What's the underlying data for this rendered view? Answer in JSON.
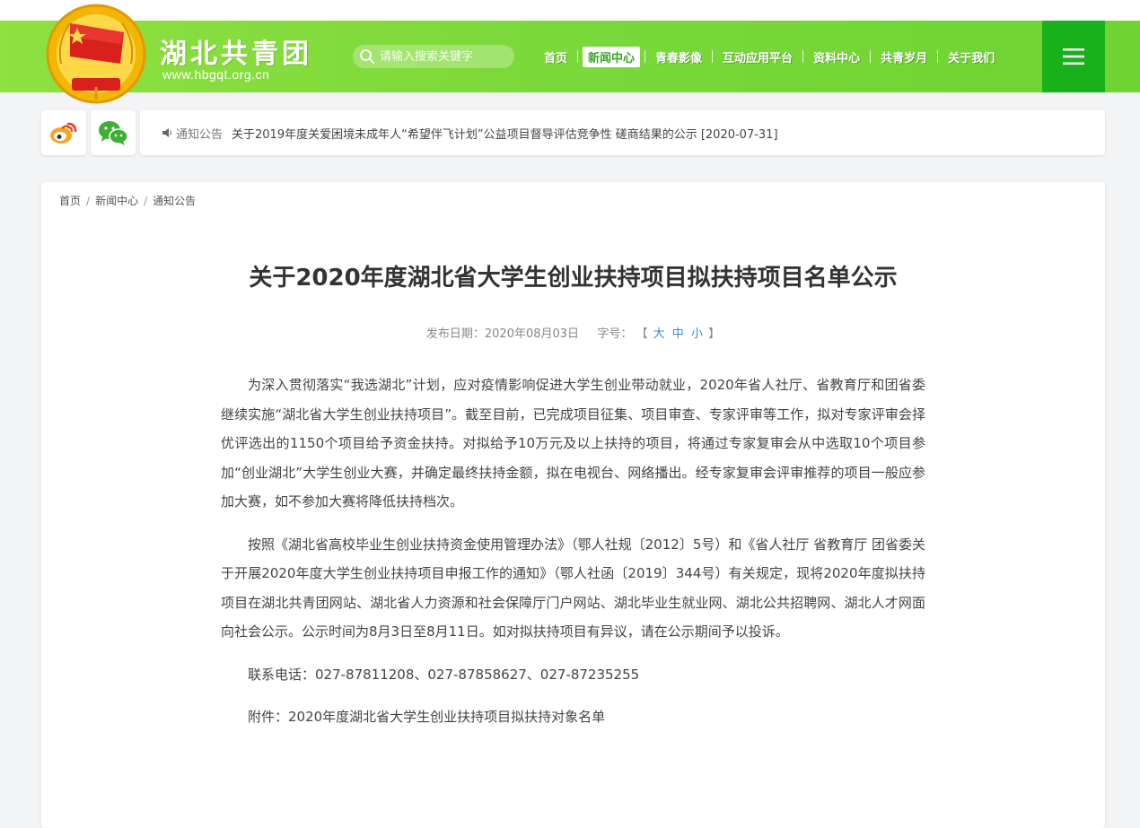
{
  "header": {
    "site_name": "湖北共青团",
    "site_url": "www.hbgqt.org.cn",
    "search_placeholder": "请输入搜索关键字",
    "nav": [
      {
        "label": "首页",
        "active": false
      },
      {
        "label": "新闻中心",
        "active": true
      },
      {
        "label": "青春影像",
        "active": false
      },
      {
        "label": "互动应用平台",
        "active": false
      },
      {
        "label": "资料中心",
        "active": false
      },
      {
        "label": "共青岁月",
        "active": false
      },
      {
        "label": "关于我们",
        "active": false
      }
    ],
    "menu_icon": "hamburger-icon",
    "colors": {
      "header_green": "#7ad83a",
      "menu_green": "#18b01b"
    }
  },
  "social": {
    "weibo_icon": "weibo-icon",
    "wechat_icon": "wechat-icon"
  },
  "notice": {
    "label": "通知公告",
    "text": "关于2019年度关爱困境未成年人“希望伴飞计划”公益项目督导评估竞争性 磋商结果的公示 [2020-07-31]"
  },
  "breadcrumb": [
    "首页",
    "新闻中心",
    "通知公告"
  ],
  "article": {
    "title": "关于2020年度湖北省大学生创业扶持项目拟扶持项目名单公示",
    "date_label": "发布日期：2020年08月03日",
    "font_label": "字号：",
    "bracket_open": "【",
    "bracket_close": "】",
    "font_sizes": [
      "大",
      "中",
      "小"
    ],
    "paragraphs": [
      "为深入贯彻落实“我选湖北”计划，应对疫情影响促进大学生创业带动就业，2020年省人社厅、省教育厅和团省委继续实施“湖北省大学生创业扶持项目”。截至目前，已完成项目征集、项目审查、专家评审等工作，拟对专家评审会择优评选出的1150个项目给予资金扶持。对拟给予10万元及以上扶持的项目，将通过专家复审会从中选取10个项目参加“创业湖北”大学生创业大赛，并确定最终扶持金额，拟在电视台、网络播出。经专家复审会评审推荐的项目一般应参加大赛，如不参加大赛将降低扶持档次。",
      "按照《湖北省高校毕业生创业扶持资金使用管理办法》（鄂人社规〔2012〕5号）和《省人社厅 省教育厅 团省委关于开展2020年度大学生创业扶持项目申报工作的通知》（鄂人社函〔2019〕344号）有关规定，现将2020年度拟扶持项目在湖北共青团网站、湖北省人力资源和社会保障厅门户网站、湖北毕业生就业网、湖北公共招聘网、湖北人才网面向社会公示。公示时间为8月3日至8月11日。如对拟扶持项目有异议，请在公示期间予以投诉。",
      "联系电话：027-87811208、027-87858627、027-87235255",
      "附件：2020年度湖北省大学生创业扶持项目拟扶持对象名单"
    ]
  }
}
